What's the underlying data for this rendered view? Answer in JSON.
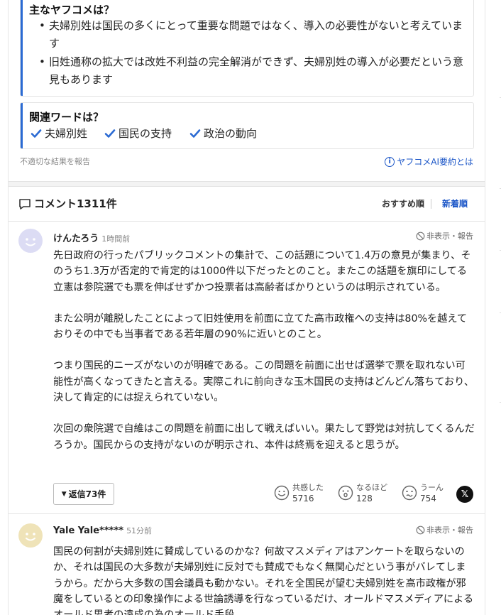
{
  "summary": {
    "main_title": "主なヤフコメは？",
    "bullets": [
      "夫婦別姓は国民の多くにとって重要な問題ではなく、導入の必要性がないと考えています",
      "旧姓通称の拡大では改姓不利益の完全解消ができず、夫婦別姓の導入が必要だという意見もあります"
    ],
    "related_title": "関連ワードは？",
    "related_words": [
      "夫婦別姓",
      "国民の支持",
      "政治の動向"
    ],
    "report_link": "不適切な結果を報告",
    "ai_link": "ヤフコメAI要約とは",
    "ai_icon_char": "i"
  },
  "comments_header": {
    "title": "コメント1311件",
    "sort_recommended": "おすすめ順",
    "sort_newest": "新着順"
  },
  "comments": [
    {
      "name": "けんたろう",
      "time": "1時間前",
      "hide_report": "非表示・報告",
      "paragraphs": [
        "先日政府の行ったパブリックコメントの集計で、この話題について1.4万の意見が集まり、そのうち1.3万が否定的で肯定的は1000件以下だったとのこと。またこの話題を旗印にしてる立憲は参院選でも票を伸ばせずかつ投票者は高齢者ばかりというのは明示されている。",
        "また公明が離脱したことによって旧姓使用を前面に立てた高市政権への支持は80%を越えておりその中でも当事者である若年層の90%に近いとのこと。",
        "つまり国民的ニーズがないのが明確である。この問題を前面に出せば選挙で票を取れない可能性が高くなってきたと言える。実際これに前向きな玉木国民の支持はどんどん落ちており、決して肯定的には捉えられていない。",
        "次回の衆院選で自維はこの問題を前面に出して戦えばいい。果たして野党は対抗してくるんだろうか。国民からの支持がないのが明示され、本件は終焉を迎えると思うが。"
      ],
      "reply_label": "返信73件",
      "reactions": [
        {
          "label": "共感した",
          "count": "5716"
        },
        {
          "label": "なるほど",
          "count": "128"
        },
        {
          "label": "うーん",
          "count": "754"
        }
      ],
      "share_label": "𝕏"
    },
    {
      "name": "Yale Yale*****",
      "time": "51分前",
      "hide_report": "非表示・報告",
      "paragraphs": [
        "国民の何割が夫婦別姓に賛成しているのかな？何故マスメディアはアンケートを取らないのか、それは国民の大多数が夫婦別姓に反対でも賛成でもなく無関心だという事がバレてしまうから。だから大多数の国会議員も動かない。それを全国民が望む夫婦別姓を高市政権が邪魔をしているとの印象操作による世論誘導を行なっているだけ、オールドマスメディアによるオールド思考の遠成の為のオールド手段。"
      ]
    }
  ],
  "colors": {
    "accent_blue": "#2a6ad3",
    "link_blue": "#1a55c7",
    "avatar_purple": "#dcdcf4",
    "avatar_yellow": "#efe3b8"
  }
}
